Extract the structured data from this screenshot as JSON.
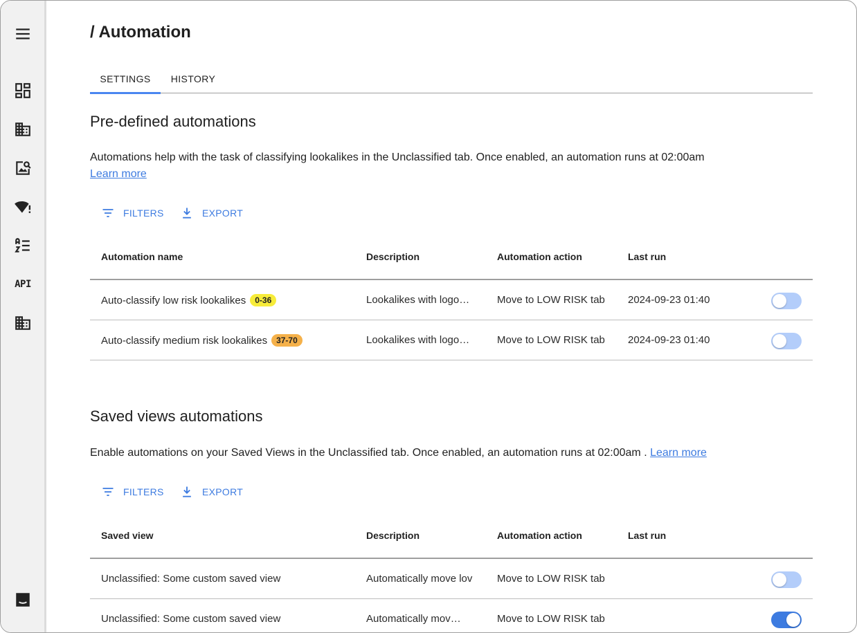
{
  "sidebar": {
    "api_label": "API"
  },
  "header": {
    "title": "/ Automation"
  },
  "tabs": [
    {
      "label": "SETTINGS",
      "active": true
    },
    {
      "label": "HISTORY",
      "active": false
    }
  ],
  "predefined": {
    "title": "Pre-defined automations",
    "description": "Automations help with the task of classifying lookalikes in the Unclassified tab. Once enabled, an automation runs at 02:00am",
    "learn_more": "Learn more",
    "filters_label": "FILTERS",
    "export_label": "EXPORT",
    "columns": [
      "Automation name",
      "Description",
      "Automation action",
      "Last run"
    ],
    "rows": [
      {
        "name": "Auto-classify low risk lookalikes",
        "badge": "0-36",
        "badge_color": "#f7ec3a",
        "description": "Lookalikes with logo…",
        "action": "Move to LOW RISK tab",
        "last_run": "2024-09-23 01:40",
        "enabled": false
      },
      {
        "name": "Auto-classify medium risk lookalikes",
        "badge": "37-70",
        "badge_color": "#f5b14a",
        "description": "Lookalikes with logo…",
        "action": "Move to LOW RISK tab",
        "last_run": "2024-09-23 01:40",
        "enabled": false
      }
    ]
  },
  "saved_views": {
    "title": "Saved views automations",
    "description": "Enable automations on your Saved Views in the Unclassified tab. Once enabled, an automation runs at 02:00am .",
    "learn_more": "Learn more",
    "filters_label": "FILTERS",
    "export_label": "EXPORT",
    "columns": [
      "Saved view",
      "Description",
      "Automation action",
      "Last run"
    ],
    "rows": [
      {
        "name": "Unclassified: Some custom saved view",
        "description": "Automatically move lov",
        "action": "Move to LOW RISK tab",
        "last_run": "",
        "enabled": false
      },
      {
        "name": "Unclassified: Some custom saved view",
        "description": "Automatically mov…",
        "action": "Move to LOW RISK tab",
        "last_run": "",
        "enabled": true
      }
    ]
  },
  "colors": {
    "accent": "#3d7be0",
    "toggle_off": "#b3cdfa"
  }
}
